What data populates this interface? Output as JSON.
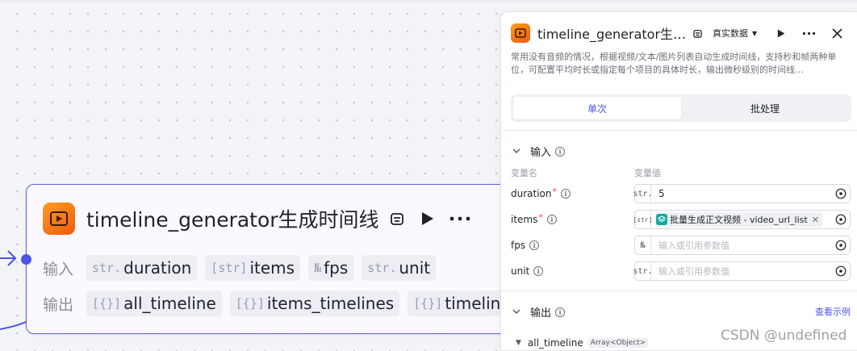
{
  "node": {
    "title": "timeline_generator生成时间线",
    "input_label": "输入",
    "output_label": "输出",
    "inputs": [
      {
        "type": "str.",
        "name": "duration"
      },
      {
        "type": "[str]",
        "name": "items"
      },
      {
        "type": "№",
        "name": "fps"
      },
      {
        "type": "str.",
        "name": "unit"
      }
    ],
    "outputs": [
      {
        "type": "[{}]",
        "name": "all_timeline"
      },
      {
        "type": "[{}]",
        "name": "items_timelines"
      },
      {
        "type": "[{}]",
        "name": "timelines"
      }
    ]
  },
  "panel": {
    "title": "timeline_generator生…",
    "data_mode": "真实数据",
    "description": "常用没有音频的情况，根据视频/文本/图片列表自动生成时间线，支持秒和帧两种单位，可配置平均时长或指定每个项目的具体时长，输出微秒级别的时间线…",
    "tabs": [
      "单次",
      "批处理"
    ],
    "input_section": "输入",
    "col_name": "变量名",
    "col_value": "变量值",
    "variables": [
      {
        "name": "duration",
        "required": true,
        "type": "str.",
        "value": "5",
        "placeholder": ""
      },
      {
        "name": "items",
        "required": true,
        "type": "[str]",
        "ref_label": "批量生成正文视频 - video_url_list",
        "placeholder": ""
      },
      {
        "name": "fps",
        "required": false,
        "type": "№",
        "value": "",
        "placeholder": "输入或引用参数值"
      },
      {
        "name": "unit",
        "required": false,
        "type": "str.",
        "value": "",
        "placeholder": "输入或引用参数值"
      }
    ],
    "output_section": "输出",
    "view_example": "查看示例",
    "output_item": {
      "name": "all_timeline",
      "type": "Array<Object>"
    }
  },
  "watermark": "CSDN @undefined",
  "colors": {
    "accent": "#4d53e8",
    "node_border": "#5b61e9",
    "icon_orange": "#ef5a12",
    "ref_teal": "#12a9a0"
  }
}
